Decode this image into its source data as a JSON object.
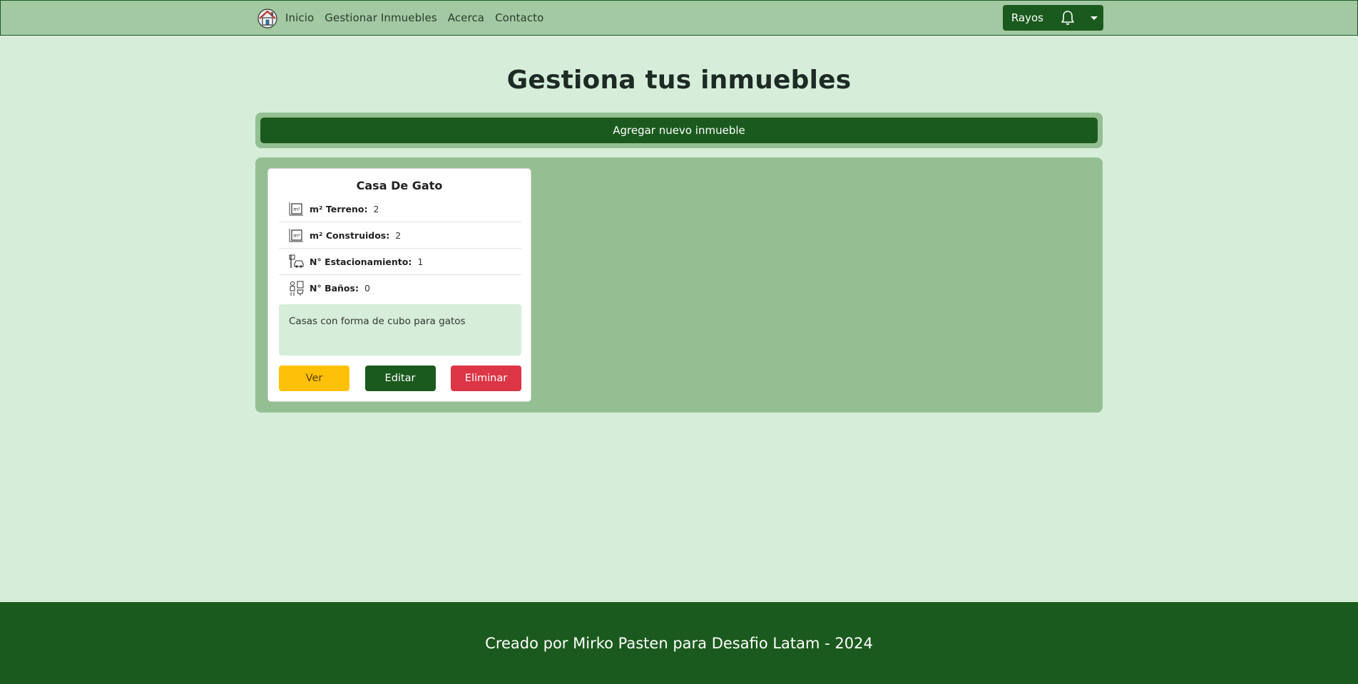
{
  "navbar": {
    "logo_icon": "home-logo-icon",
    "links": [
      "Inicio",
      "Gestionar Inmuebles",
      "Acerca",
      "Contacto"
    ],
    "user_name": "Rayos",
    "bell_icon": "bell-icon",
    "caret_icon": "caret-down-icon"
  },
  "main": {
    "title": "Gestiona tus inmuebles",
    "add_button": "Agregar nuevo inmueble"
  },
  "properties": [
    {
      "name": "Casa De Gato",
      "specs": [
        {
          "icon": "area-icon",
          "label": "m² Terreno:",
          "value": "2"
        },
        {
          "icon": "area-icon",
          "label": "m² Construidos:",
          "value": "2"
        },
        {
          "icon": "parking-icon",
          "label": "N° Estacionamiento:",
          "value": "1"
        },
        {
          "icon": "bathroom-icon",
          "label": "N° Baños:",
          "value": "0"
        }
      ],
      "description": "Casas con forma de cubo para gatos",
      "actions": {
        "view": "Ver",
        "edit": "Editar",
        "delete": "Eliminar"
      }
    }
  ],
  "footer": {
    "text": "Creado por Mirko Pasten para Desafio Latam - 2024"
  },
  "colors": {
    "background": "#d6eed9",
    "navbar": "#a3c9a2",
    "brand_green": "#1b5a1e",
    "panel": "#94bf93",
    "warning": "#ffc107",
    "danger": "#dc3545"
  }
}
